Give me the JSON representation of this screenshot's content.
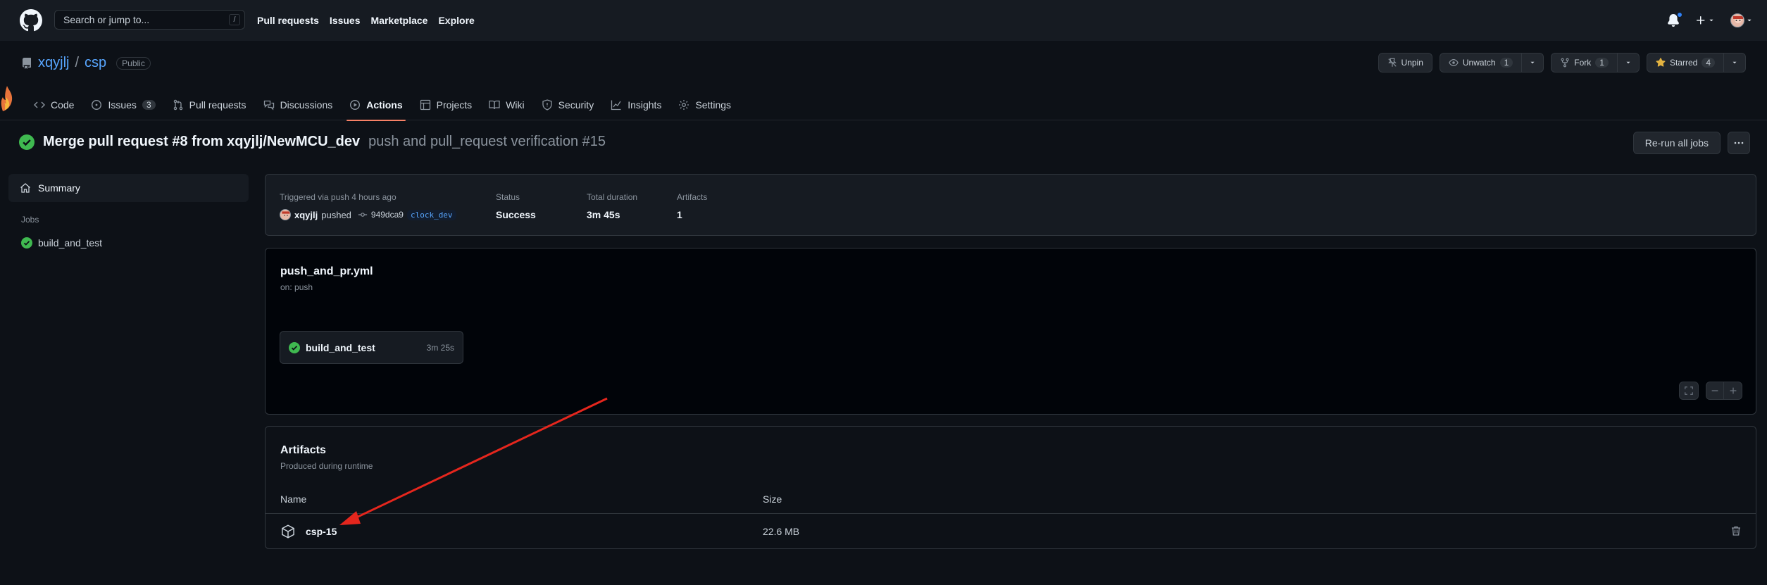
{
  "topbar": {
    "search_placeholder": "Search or jump to...",
    "search_shortcut": "/",
    "nav": [
      "Pull requests",
      "Issues",
      "Marketplace",
      "Explore"
    ]
  },
  "repo": {
    "owner": "xqyjlj",
    "separator": "/",
    "name": "csp",
    "visibility": "Public",
    "actions": {
      "unpin": "Unpin",
      "unwatch": "Unwatch",
      "unwatch_count": "1",
      "fork": "Fork",
      "fork_count": "1",
      "starred": "Starred",
      "star_count": "4"
    },
    "tabs": [
      {
        "label": "Code",
        "icon": "code-icon"
      },
      {
        "label": "Issues",
        "icon": "issue-icon",
        "count": "3"
      },
      {
        "label": "Pull requests",
        "icon": "pull-request-icon"
      },
      {
        "label": "Discussions",
        "icon": "discussions-icon"
      },
      {
        "label": "Actions",
        "icon": "play-icon",
        "selected": true
      },
      {
        "label": "Projects",
        "icon": "projects-icon"
      },
      {
        "label": "Wiki",
        "icon": "book-icon"
      },
      {
        "label": "Security",
        "icon": "shield-icon"
      },
      {
        "label": "Insights",
        "icon": "graph-icon"
      },
      {
        "label": "Settings",
        "icon": "gear-icon"
      }
    ]
  },
  "run": {
    "title": "Merge pull request #8 from xqyjlj/NewMCU_dev",
    "subtitle": "push and pull_request verification #15",
    "rerun_label": "Re-run all jobs"
  },
  "sidebar": {
    "summary_label": "Summary",
    "jobs_heading": "Jobs",
    "jobs": [
      "build_and_test"
    ]
  },
  "summary": {
    "trigger_label": "Triggered via push 4 hours ago",
    "actor": "xqyjlj",
    "action": "pushed",
    "commit": "949dca9",
    "branch": "clock_dev",
    "status_label": "Status",
    "status_value": "Success",
    "duration_label": "Total duration",
    "duration_value": "3m 45s",
    "artifacts_label": "Artifacts",
    "artifacts_value": "1"
  },
  "workflow": {
    "file": "push_and_pr.yml",
    "on": "on: push",
    "job_name": "build_and_test",
    "job_time": "3m 25s"
  },
  "artifacts": {
    "title": "Artifacts",
    "subtitle": "Produced during runtime",
    "col_name": "Name",
    "col_size": "Size",
    "rows": [
      {
        "name": "csp-15",
        "size": "22.6 MB"
      }
    ]
  },
  "colors": {
    "bg": "#0d1117",
    "header": "#161b22",
    "success": "#3fb950",
    "link": "#58a6ff",
    "tab_underline": "#f78166",
    "annotation_arrow": "#e5261d"
  }
}
